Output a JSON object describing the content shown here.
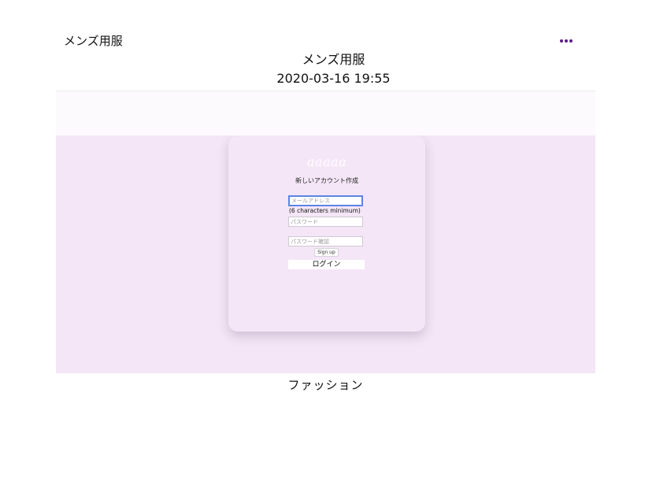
{
  "header": {
    "brand": "メンズ用服",
    "more_icon": "more-horizontal-icon",
    "accent_color": "#5b1a8f"
  },
  "post": {
    "title": "メンズ用服",
    "date": "2020-03-16 19:55",
    "caption": "ファッション"
  },
  "signup_card": {
    "logo_text": "aaaaa",
    "heading": "新しいアカウント作成",
    "email_placeholder": "メールアドレス",
    "password_hint": "(6 characters minimum)",
    "password_placeholder": "パスワード",
    "confirm_placeholder": "パスワード確認",
    "signup_label": "Sign up",
    "login_label": "ログイン",
    "background_color": "#f4e6f6"
  }
}
